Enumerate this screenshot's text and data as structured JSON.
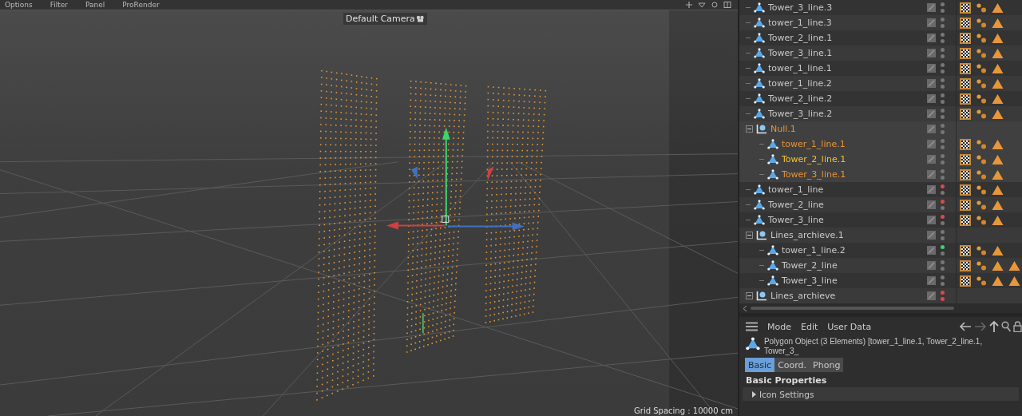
{
  "menu": [
    "Options",
    "Filter",
    "Panel",
    "ProRender"
  ],
  "viewport": {
    "camera_label": "Default Camera",
    "grid_spacing": "Grid Spacing : 10000 cm"
  },
  "object_manager": {
    "objects": [
      {
        "name": "Tower_3_line.3",
        "kind": "polygon",
        "selected": false,
        "active": false,
        "editor_on": false,
        "editor_off": false,
        "render_off": false,
        "tags": [
          {
            "kind": "texture"
          },
          {
            "kind": "points"
          },
          {
            "kind": "phong"
          }
        ]
      },
      {
        "name": "tower_1_line.3",
        "kind": "polygon",
        "selected": false,
        "active": false,
        "editor_on": false,
        "editor_off": false,
        "render_off": false,
        "tags": [
          {
            "kind": "texture"
          },
          {
            "kind": "points"
          },
          {
            "kind": "phong"
          }
        ]
      },
      {
        "name": "Tower_2_line.1",
        "kind": "polygon",
        "selected": false,
        "active": false,
        "editor_on": false,
        "editor_off": false,
        "render_off": false,
        "tags": [
          {
            "kind": "texture"
          },
          {
            "kind": "points"
          },
          {
            "kind": "phong"
          }
        ]
      },
      {
        "name": "Tower_3_line.1",
        "kind": "polygon",
        "selected": false,
        "active": false,
        "editor_on": false,
        "editor_off": false,
        "render_off": false,
        "tags": [
          {
            "kind": "texture"
          },
          {
            "kind": "points"
          },
          {
            "kind": "phong"
          }
        ]
      },
      {
        "name": "tower_1_line.1",
        "kind": "polygon",
        "selected": false,
        "active": false,
        "editor_on": false,
        "editor_off": false,
        "render_off": false,
        "tags": [
          {
            "kind": "texture"
          },
          {
            "kind": "points"
          },
          {
            "kind": "phong"
          }
        ]
      },
      {
        "name": "tower_1_line.2",
        "kind": "polygon",
        "selected": false,
        "active": false,
        "editor_on": false,
        "editor_off": false,
        "render_off": false,
        "tags": [
          {
            "kind": "texture"
          },
          {
            "kind": "points"
          },
          {
            "kind": "phong"
          }
        ]
      },
      {
        "name": "Tower_2_line.2",
        "kind": "polygon",
        "selected": false,
        "active": false,
        "editor_on": false,
        "editor_off": false,
        "render_off": false,
        "tags": [
          {
            "kind": "texture"
          },
          {
            "kind": "points"
          },
          {
            "kind": "phong"
          }
        ]
      },
      {
        "name": "Tower_3_line.2",
        "kind": "polygon",
        "selected": false,
        "active": false,
        "editor_on": false,
        "editor_off": false,
        "render_off": false,
        "tags": [
          {
            "kind": "texture"
          },
          {
            "kind": "points"
          },
          {
            "kind": "phong"
          }
        ]
      },
      {
        "name": "Null.1",
        "kind": "null",
        "selected": true,
        "active": false,
        "expanded": true,
        "editor_on": false,
        "editor_off": false,
        "render_off": false,
        "children": [
          {
            "name": "tower_1_line.1",
            "kind": "polygon",
            "selected": true,
            "active": false,
            "editor_on": false,
            "editor_off": false,
            "render_off": false,
            "tags": [
              {
                "kind": "texture"
              },
              {
                "kind": "points"
              },
              {
                "kind": "phong"
              }
            ]
          },
          {
            "name": "Tower_2_line.1",
            "kind": "polygon",
            "selected": true,
            "active": true,
            "editor_on": false,
            "editor_off": false,
            "render_off": false,
            "tags": [
              {
                "kind": "texture"
              },
              {
                "kind": "points"
              },
              {
                "kind": "phong"
              }
            ]
          },
          {
            "name": "Tower_3_line.1",
            "kind": "polygon",
            "selected": true,
            "active": false,
            "editor_on": false,
            "editor_off": false,
            "render_off": false,
            "tags": [
              {
                "kind": "texture"
              },
              {
                "kind": "points"
              },
              {
                "kind": "phong"
              }
            ]
          }
        ]
      },
      {
        "name": "tower_1_line",
        "kind": "polygon",
        "selected": false,
        "active": false,
        "editor_on": false,
        "editor_off": true,
        "render_off": false,
        "tags": [
          {
            "kind": "texture"
          },
          {
            "kind": "points"
          },
          {
            "kind": "phong"
          }
        ]
      },
      {
        "name": "Tower_2_line",
        "kind": "polygon",
        "selected": false,
        "active": false,
        "editor_on": false,
        "editor_off": true,
        "render_off": false,
        "tags": [
          {
            "kind": "texture"
          },
          {
            "kind": "points"
          },
          {
            "kind": "phong"
          }
        ]
      },
      {
        "name": "Tower_3_line",
        "kind": "polygon",
        "selected": false,
        "active": false,
        "editor_on": false,
        "editor_off": true,
        "render_off": false,
        "tags": [
          {
            "kind": "texture"
          },
          {
            "kind": "points"
          },
          {
            "kind": "phong"
          }
        ]
      },
      {
        "name": "Lines_archieve.1",
        "kind": "null",
        "selected": false,
        "active": false,
        "expanded": true,
        "editor_on": false,
        "editor_off": false,
        "render_off": false,
        "children": [
          {
            "name": "tower_1_line.2",
            "kind": "polygon",
            "selected": false,
            "active": false,
            "editor_on": true,
            "editor_off": false,
            "render_off": false,
            "tags": [
              {
                "kind": "texture"
              },
              {
                "kind": "points"
              },
              {
                "kind": "phong"
              }
            ]
          },
          {
            "name": "Tower_2_line",
            "kind": "polygon",
            "selected": false,
            "active": false,
            "editor_on": false,
            "editor_off": false,
            "render_off": false,
            "tags": [
              {
                "kind": "texture"
              },
              {
                "kind": "points"
              },
              {
                "kind": "phong"
              },
              {
                "kind": "phong"
              }
            ]
          },
          {
            "name": "Tower_3_line",
            "kind": "polygon",
            "selected": false,
            "active": false,
            "editor_on": false,
            "editor_off": false,
            "render_off": false,
            "tags": [
              {
                "kind": "texture"
              },
              {
                "kind": "points"
              },
              {
                "kind": "phong"
              },
              {
                "kind": "phong"
              }
            ]
          }
        ]
      },
      {
        "name": "Lines_archieve",
        "kind": "null",
        "selected": false,
        "active": false,
        "expanded": true,
        "editor_on": false,
        "editor_off": true,
        "render_off": true
      }
    ]
  },
  "attributes": {
    "menu": [
      "Mode",
      "Edit",
      "User Data"
    ],
    "object_title": "Polygon Object (3 Elements) [tower_1_line.1, Tower_2_line.1, Tower_3_",
    "tabs": [
      {
        "label": "Basic",
        "selected": true
      },
      {
        "label": "Coord.",
        "selected": false
      },
      {
        "label": "Phong",
        "selected": false
      }
    ],
    "section": "Basic Properties",
    "groups": [
      {
        "label": "Icon Settings",
        "expanded": false
      }
    ]
  }
}
